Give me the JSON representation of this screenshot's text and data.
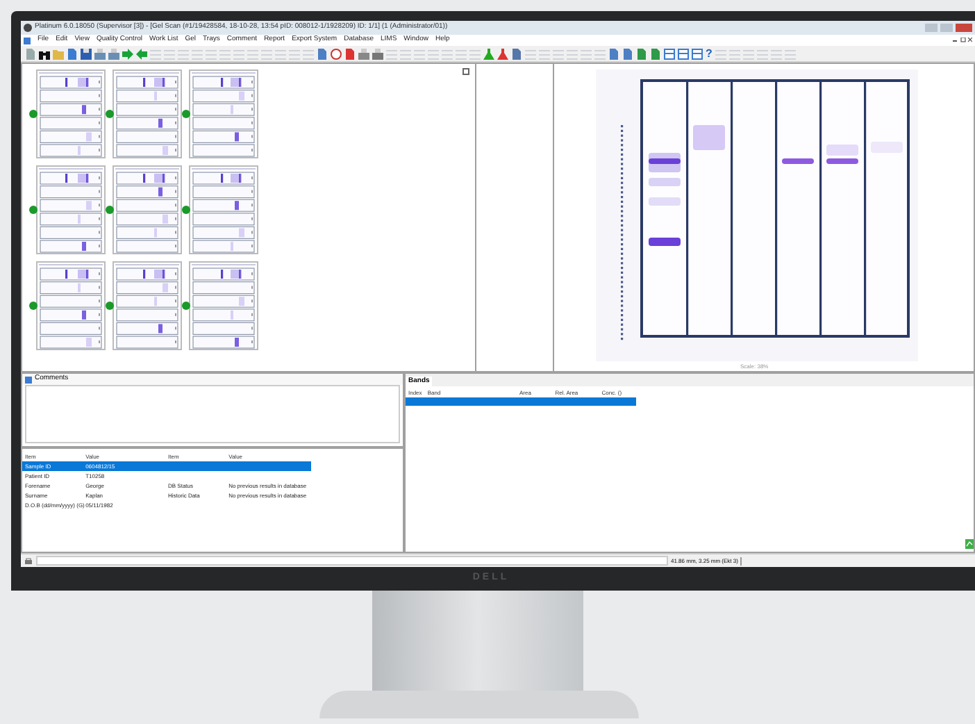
{
  "window": {
    "title": "Platinum 6.0.18050 (Supervisor [3]) - [Gel Scan (#1/19428584, 18-10-28, 13:54 pID: 008012-1/1928209) ID: 1/1] (1 (Administrator/01))"
  },
  "menu": [
    "File",
    "Edit",
    "View",
    "Quality Control",
    "Work List",
    "Gel",
    "Trays",
    "Comment",
    "Report",
    "Export System",
    "Database",
    "LIMS",
    "Window",
    "Help"
  ],
  "toolbar": {
    "help_glyph": "?"
  },
  "gel": {
    "caption": "Scale: 38%"
  },
  "comments": {
    "title": "Comments"
  },
  "details": {
    "columns": [
      "Item",
      "Value",
      "Item",
      "Value"
    ],
    "rows": [
      {
        "item": "Sample ID",
        "value": "0604812/15",
        "selected": true
      },
      {
        "item": "Patient ID",
        "value": "T10258",
        "selected": false
      },
      {
        "item": "Forename",
        "value": "George",
        "item_2": "DB Status",
        "value_2": "No previous results in database",
        "selected": false
      },
      {
        "item": "Surname",
        "value": "Kaplan",
        "item_2": "Historic Data",
        "value_2": "No previous results in database",
        "selected": false
      },
      {
        "item": "D.O.B (dd/mm/yyyy) (G)",
        "value": "05/11/1982",
        "selected": false
      }
    ]
  },
  "bands": {
    "title": "Bands",
    "columns": [
      "Index",
      "Band",
      "Area",
      "Rel. Area",
      "Conc. ()"
    ],
    "rows": [
      {
        "selected": true
      }
    ]
  },
  "status_bar": {
    "position": "41.86 mm, 3.25 mm (Ekt 3)"
  },
  "monitor": {
    "brand": "DELL"
  }
}
